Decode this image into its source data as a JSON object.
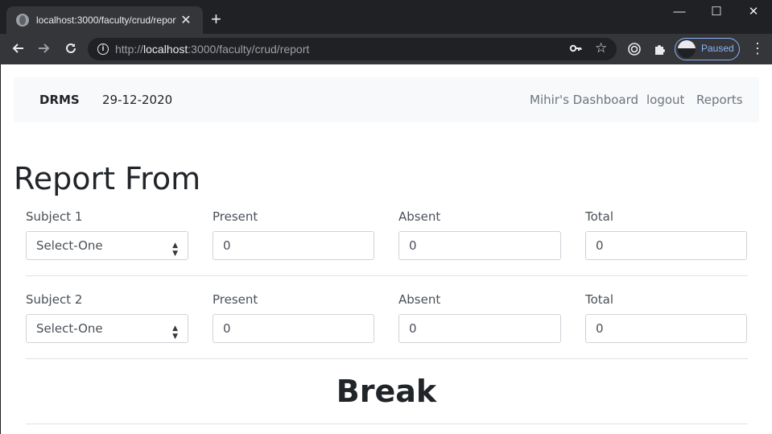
{
  "browser": {
    "tab_title": "localhost:3000/faculty/crud/report",
    "tab_close": "✕",
    "new_tab": "+",
    "url_scheme": "http://",
    "url_host": "localhost",
    "url_rest": ":3000/faculty/crud/report",
    "profile_label": "Paused",
    "window_controls": {
      "minimize": "—",
      "maximize": "☐",
      "close": "✕"
    },
    "icons": [
      "back-icon",
      "forward-icon",
      "reload-icon",
      "info-icon",
      "key-icon",
      "star-icon",
      "media-icon",
      "extensions-icon",
      "menu-icon"
    ]
  },
  "navbar": {
    "brand": "DRMS",
    "date": "29-12-2020",
    "links": [
      "Mihir's Dashboard",
      "logout",
      "Reports"
    ]
  },
  "form": {
    "title": "Report From",
    "rows": [
      {
        "subject_label": "Subject 1",
        "subject_value": "Select-One",
        "present_label": "Present",
        "present_value": "0",
        "absent_label": "Absent",
        "absent_value": "0",
        "total_label": "Total",
        "total_value": "0"
      },
      {
        "subject_label": "Subject 2",
        "subject_value": "Select-One",
        "present_label": "Present",
        "present_value": "0",
        "absent_label": "Absent",
        "absent_value": "0",
        "total_label": "Total",
        "total_value": "0"
      }
    ],
    "break_heading": "Break"
  },
  "colors": {
    "navbar_bg": "#f8f9fa",
    "link": "#6c757d",
    "text": "#212529",
    "border": "#ced4da",
    "browser_dark": "#202124",
    "profile_accent": "#8ab4f8"
  }
}
